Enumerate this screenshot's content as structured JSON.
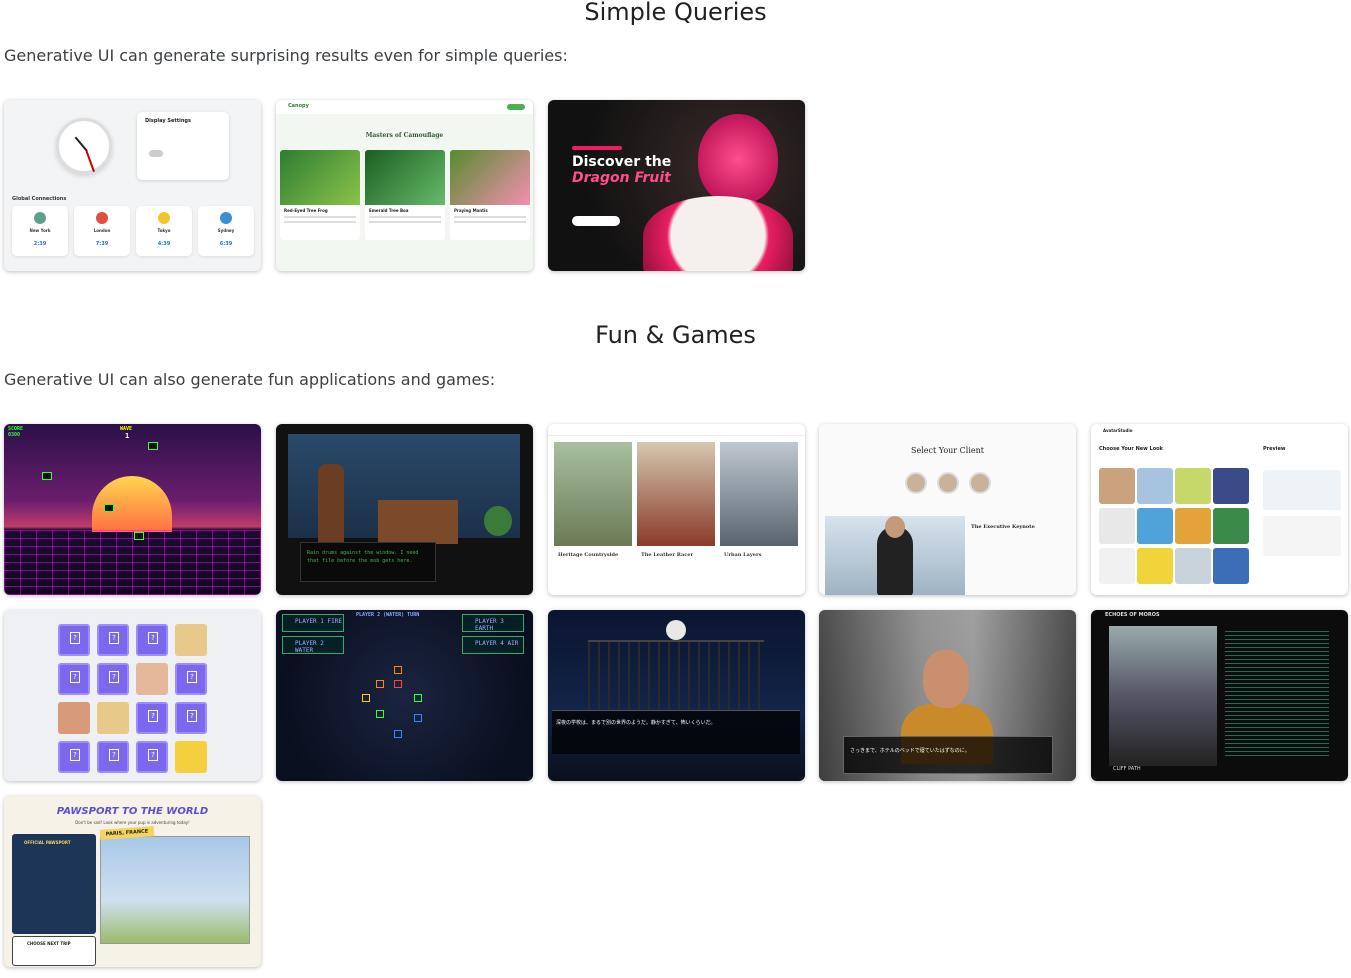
{
  "sections": [
    {
      "title": "Simple Queries",
      "description": "Generative UI can generate surprising results even for simple queries:"
    },
    {
      "title": "Fun & Games",
      "description": "Generative UI can also generate fun applications and games:"
    }
  ],
  "thumbs": {
    "clock": {
      "settings_title": "Display Settings",
      "connections_title": "Global Connections",
      "cities": [
        {
          "name": "New York",
          "time": "2:39"
        },
        {
          "name": "London",
          "time": "7:39"
        },
        {
          "name": "Tokyo",
          "time": "4:39"
        },
        {
          "name": "Sydney",
          "time": "6:39"
        }
      ]
    },
    "nature": {
      "brand": "Canopy",
      "heading": "Masters of Camouflage",
      "cards": [
        "Red-Eyed Tree Frog",
        "Emerald Tree Boa",
        "Praying Mantis"
      ]
    },
    "dragonfruit": {
      "heading_1": "Discover the",
      "heading_2": "Dragon Fruit"
    },
    "retro": {
      "score_label": "SCORE",
      "score_value": "0300",
      "wave_label": "WAVE",
      "wave_value": "1"
    },
    "detective": {
      "dialog": "Rain drums against the window. I need that file before the mob gets here."
    },
    "portraits": {
      "captions": [
        "Heritage Countryside",
        "The Leather Racer",
        "Urban Layers"
      ]
    },
    "keynote": {
      "title": "Select Your Client",
      "subtitle": "The Executive Keynote"
    },
    "avatar": {
      "brand": "AvatarStudio",
      "heading": "Choose Your New Look",
      "preview": "Preview"
    },
    "spacegame": {
      "turn": "PLAYER 2 (WATER) TURN",
      "players": [
        "PLAYER 1 FIRE",
        "PLAYER 2 WATER",
        "PLAYER 3 EARTH",
        "PLAYER 4 AIR"
      ]
    },
    "vn": {
      "dialog": "深夜の学校は、まるで別の世界のようだ。静かすぎて、怖いくらいだ。"
    },
    "hotel": {
      "dialog": "さっきまで、ホテルのベッドで寝ていたはずなのに。"
    },
    "moros": {
      "title": "ECHOES OF MOROS",
      "place": "CLIFF PATH"
    },
    "pawsport": {
      "title": "PAWSPORT TO THE WORLD",
      "subtitle": "Don't be sad! Look where your pup is adventuring today!",
      "tag": "PARIS, FRANCE",
      "passport": "OFFICIAL PAWSPORT",
      "next": "CHOOSE NEXT TRIP"
    }
  }
}
